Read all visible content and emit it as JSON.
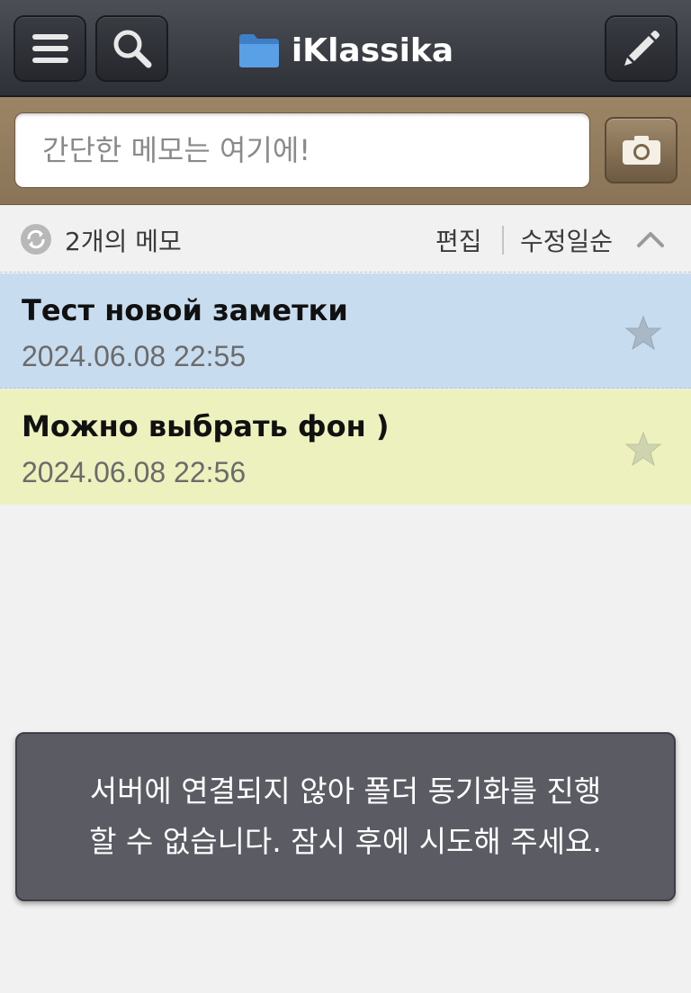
{
  "header": {
    "title": "iKlassika",
    "menu_icon": "hamburger-menu-icon",
    "search_icon": "search-icon",
    "folder_icon": "folder-icon",
    "write_icon": "pencil-icon"
  },
  "quick_memo": {
    "placeholder": "간단한 메모는 여기에!",
    "camera_icon": "camera-icon"
  },
  "status": {
    "count_label": "2개의 메모",
    "edit_label": "편집",
    "sort_label": "수정일순"
  },
  "memos": [
    {
      "title": "Тест новой заметки",
      "date": "2024.06.08 22:55",
      "color": "#c8dcef"
    },
    {
      "title": "Можно выбрать фон )",
      "date": "2024.06.08 22:56",
      "color": "#edf1bd"
    }
  ],
  "toast": {
    "message": "서버에 연결되지 않아 폴더 동기화를 진행할 수 없습니다. 잠시 후에 시도해 주세요."
  },
  "colors": {
    "topbar": "#3a3c43",
    "inputband": "#9c8566",
    "toast_bg": "#5a5b63"
  }
}
